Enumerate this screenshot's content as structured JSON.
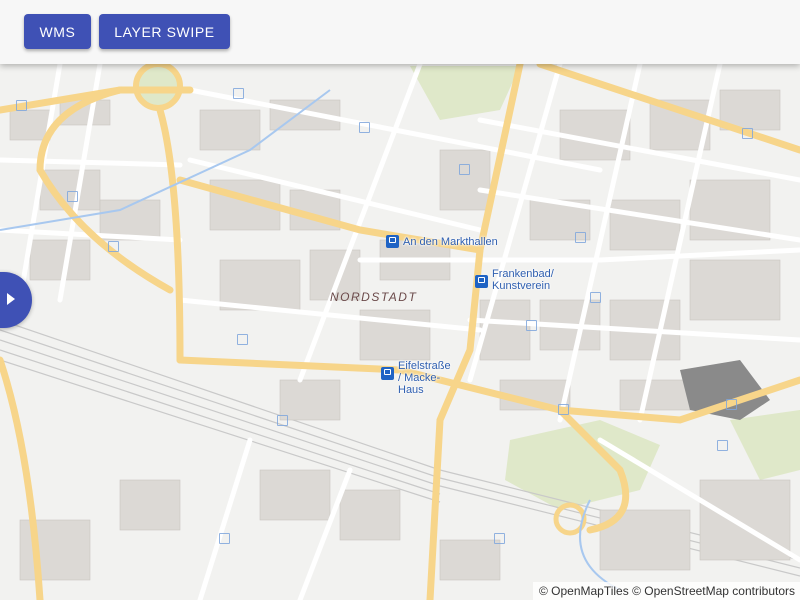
{
  "toolbar": {
    "buttons": [
      {
        "label": "WMS"
      },
      {
        "label": "LAYER SWIPE"
      }
    ]
  },
  "map": {
    "district_label": "NORDSTADT",
    "stops": [
      {
        "label": "An den Markthallen"
      },
      {
        "label": "Frankenbad/ Kunstverein"
      },
      {
        "label": "Eifelstraße / Macke-Haus"
      }
    ],
    "colors": {
      "background": "#f2f2f0",
      "major_road": "#f7d58a",
      "minor_road": "#ffffff",
      "building": "#d9d6d2",
      "park": "#dfe8c9",
      "water": "#a8c8ef",
      "stop_icon": "#1f63c4"
    },
    "swipe_handle_icon": "play-arrow-icon",
    "attribution": {
      "tiles": "© OpenMapTiles",
      "osm": "© OpenStreetMap contributors"
    }
  }
}
